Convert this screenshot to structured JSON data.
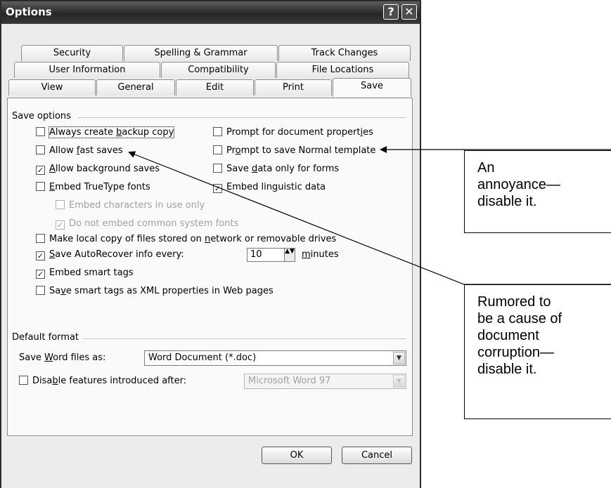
{
  "dialog": {
    "title": "Options",
    "help_glyph": "?",
    "close_glyph": "✕"
  },
  "tabs": {
    "row1": [
      "Security",
      "Spelling & Grammar",
      "Track Changes"
    ],
    "row2": [
      "User Information",
      "Compatibility",
      "File Locations"
    ],
    "row3": [
      "View",
      "General",
      "Edit",
      "Print",
      "Save"
    ],
    "active": "Save"
  },
  "save_options": {
    "heading": "Save options",
    "always_backup": {
      "pre": "Always create ",
      "key": "b",
      "post": "ackup copy",
      "checked": false
    },
    "allow_fast": {
      "pre": "Allow ",
      "key": "f",
      "post": "ast saves",
      "checked": false
    },
    "allow_background": {
      "pre": "",
      "key": "A",
      "post": "llow background saves",
      "checked": true
    },
    "embed_truetype": {
      "pre": "",
      "key": "E",
      "post": "mbed TrueType fonts",
      "checked": false
    },
    "embed_chars": {
      "pre": "Embed characters in use only",
      "key": "",
      "post": "",
      "checked": false
    },
    "no_common_fonts": {
      "pre": "Do not embed common system fonts",
      "key": "",
      "post": "",
      "checked": true
    },
    "prompt_doc_props": {
      "pre": "Prompt for document propert",
      "key": "i",
      "post": "es",
      "checked": false
    },
    "prompt_normal": {
      "pre": "Pr",
      "key": "o",
      "post": "mpt to save Normal template",
      "checked": false
    },
    "save_data_forms": {
      "pre": "Save ",
      "key": "d",
      "post": "ata only for forms",
      "checked": false
    },
    "embed_linguistic": {
      "pre": "Embed lin",
      "key": "g",
      "post": "uistic data",
      "checked": true
    },
    "local_copy": {
      "pre": "Make local copy of files stored on ",
      "key": "n",
      "post": "etwork or removable drives",
      "checked": false
    },
    "autorecover": {
      "pre": "",
      "key": "S",
      "post": "ave AutoRecover info every:",
      "checked": true
    },
    "autorecover_value": "10",
    "minutes": {
      "pre": "",
      "key": "m",
      "post": "inutes"
    },
    "embed_smart_tags": {
      "pre": "Embed smart ta",
      "key": "g",
      "post": "s",
      "checked": true
    },
    "save_smart_xml": {
      "pre": "Sa",
      "key": "v",
      "post": "e smart tags as XML properties in Web pages",
      "checked": false
    }
  },
  "default_format": {
    "heading": "Default format",
    "save_as_label": {
      "pre": "Save ",
      "key": "W",
      "post": "ord files as:"
    },
    "save_as_value": "Word Document (*.doc)",
    "disable_features": {
      "pre": "Disa",
      "key": "b",
      "post": "le features introduced after:",
      "checked": false
    },
    "disable_value": "Microsoft Word 97"
  },
  "buttons": {
    "ok": "OK",
    "cancel": "Cancel"
  },
  "callouts": {
    "first": [
      "An",
      "annoyance—",
      "disable it."
    ],
    "second": [
      "Rumored to",
      "be a cause of",
      "document",
      "corruption—",
      "disable it."
    ]
  },
  "glyphs": {
    "check": "✓",
    "spin": "▲▼",
    "dropdown": "▼"
  }
}
